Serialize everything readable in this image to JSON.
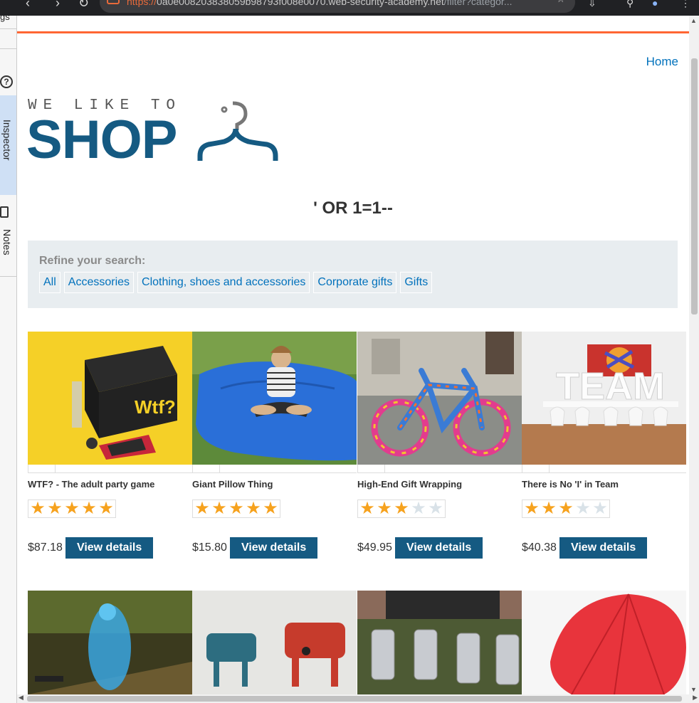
{
  "browser": {
    "url_scheme": "https://",
    "url_host": "0a0e008203838059b98793f008e0070.web-security-academy.net",
    "url_path": "/filter?categor..."
  },
  "sidebar": {
    "top_label": "gs",
    "inspector_label": "Inspector",
    "notes_label": "Notes"
  },
  "header": {
    "home_link": "Home"
  },
  "logo": {
    "tagline": "WE LIKE TO",
    "word": "SHOP"
  },
  "search_title": "' OR 1=1--",
  "refine": {
    "label": "Refine your search:",
    "filters": [
      "All",
      "Accessories",
      "Clothing, shoes and accessories",
      "Corporate gifts",
      "Gifts"
    ]
  },
  "products": [
    {
      "name": "WTF? - The adult party game",
      "price": "$87.18",
      "rating": 5,
      "button": "View details"
    },
    {
      "name": "Giant Pillow Thing",
      "price": "$15.80",
      "rating": 5,
      "button": "View details"
    },
    {
      "name": "High-End Gift Wrapping",
      "price": "$49.95",
      "rating": 3,
      "button": "View details"
    },
    {
      "name": "There is No 'I' in Team",
      "price": "$40.38",
      "rating": 3,
      "button": "View details"
    }
  ],
  "colors": {
    "accent": "#ff6633",
    "brand": "#155a82",
    "link": "#0071bc",
    "star_on": "#f6a21e",
    "star_off": "#d9e2e8"
  }
}
